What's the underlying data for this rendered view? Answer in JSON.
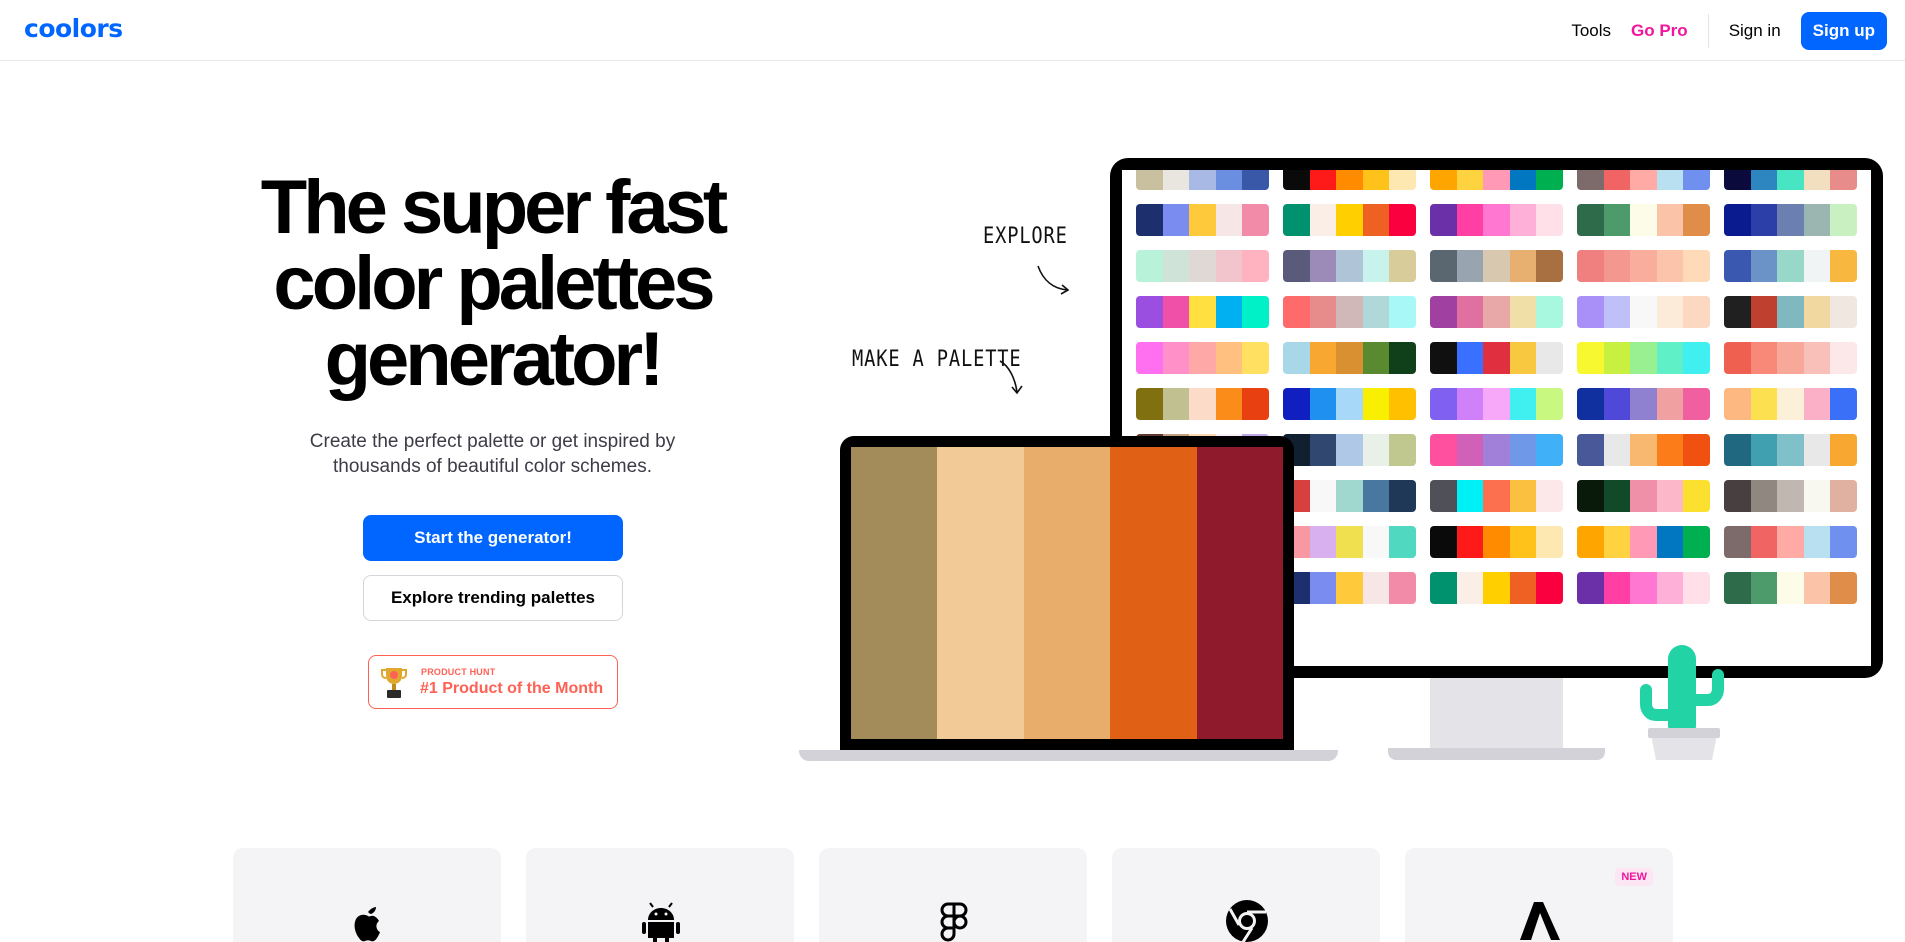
{
  "header": {
    "logo": "coolors",
    "nav": {
      "tools": "Tools",
      "go_pro": "Go Pro",
      "sign_in": "Sign in",
      "sign_up": "Sign up"
    }
  },
  "hero": {
    "title_lines": [
      "The super fast",
      "color palettes",
      "generator!"
    ],
    "subtitle_line1": "Create the perfect palette or get inspired by",
    "subtitle_line2": "thousands of beautiful color schemes.",
    "primary_button": "Start the generator!",
    "secondary_button": "Explore trending palettes",
    "badge": {
      "small": "PRODUCT HUNT",
      "big": "#1 Product of the Month"
    }
  },
  "illustration": {
    "explore_label": "EXPLORE",
    "make_label": "MAKE A PALETTE",
    "laptop_palette": [
      "#a38c5a",
      "#f2ca97",
      "#e8ad6b",
      "#e06016",
      "#8f1a2b"
    ],
    "monitor_palettes": [
      [
        "#c9c0a0",
        "#e8e6df",
        "#a8b9e6",
        "#6b8fe0",
        "#3a58a8"
      ],
      [
        "#0a0a0a",
        "#ff1a1a",
        "#ff8c00",
        "#ffc21a",
        "#fce8b0"
      ],
      [
        "#ffa500",
        "#ffd23f",
        "#ff99b6",
        "#0077c0",
        "#00b050"
      ],
      [
        "#7d6b6b",
        "#f06464",
        "#ffaaa5",
        "#b8e0f0",
        "#7090f0"
      ],
      [
        "#0a0a3c",
        "#2e86c1",
        "#48e5c2",
        "#f2dfc0",
        "#e88b8b"
      ],
      [
        "#1e2f6e",
        "#7a8cf0",
        "#ffc93c",
        "#f7e6e6",
        "#f28ba8"
      ],
      [
        "#00916e",
        "#fbeee6",
        "#ffcf00",
        "#ee6123",
        "#fa003f"
      ],
      [
        "#6b2fa8",
        "#ff3fa4",
        "#ff77d0",
        "#ffb0d9",
        "#ffe0e8"
      ],
      [
        "#2e6b4a",
        "#4d9a6a",
        "#fcfce8",
        "#fbc4a8",
        "#e08d4a"
      ],
      [
        "#0a1a8f",
        "#2c3fa8",
        "#6b7fb0",
        "#9bb5b0",
        "#c8f0c0"
      ],
      [
        "#b8f2d8",
        "#cfe3d8",
        "#e0d8d5",
        "#f2c4cc",
        "#ffb3c0"
      ],
      [
        "#5a5a7a",
        "#9c8ab8",
        "#b0c4d8",
        "#c8f2ec",
        "#d8cc9a"
      ],
      [
        "#5a6670",
        "#98a4b0",
        "#d8c8b0",
        "#e8b070",
        "#a87040"
      ],
      [
        "#f08080",
        "#f4978e",
        "#f8ad9d",
        "#fbc4ab",
        "#ffdab9"
      ],
      [
        "#3a58b0",
        "#6b93c8",
        "#98d8c8",
        "#f0f4f4",
        "#f8b840"
      ],
      [
        "#9a4fe0",
        "#f050a8",
        "#ffe040",
        "#00b0f0",
        "#00f0c8"
      ],
      [
        "#ff6b6b",
        "#e88b8b",
        "#d0b8b8",
        "#b0d8d8",
        "#a8f8f8"
      ],
      [
        "#a040a0",
        "#e070a0",
        "#e8a8a8",
        "#f0e0a8",
        "#a8f8e0"
      ],
      [
        "#a890f8",
        "#c0c0f8",
        "#f8f8f8",
        "#fcebd8",
        "#fcd8c0"
      ],
      [
        "#202020",
        "#c04030",
        "#80b8c0",
        "#f0d8a0",
        "#f0e8e0"
      ],
      [
        "#ff70f0",
        "#ff90c8",
        "#ffa8a8",
        "#ffc080",
        "#ffe060"
      ],
      [
        "#a8d8e8",
        "#f8a830",
        "#d89030",
        "#5a8a30",
        "#10401a"
      ],
      [
        "#101010",
        "#3a70ff",
        "#e03040",
        "#f8c840",
        "#e8e8e8"
      ],
      [
        "#f8f830",
        "#c8f040",
        "#98f090",
        "#60f0c8",
        "#40f0f0"
      ],
      [
        "#f06050",
        "#f88878",
        "#f8a898",
        "#f8c0b8",
        "#fce8e8"
      ],
      [
        "#807010",
        "#c0c090",
        "#fcdcc8",
        "#fc8c1a",
        "#e84010"
      ],
      [
        "#1020c0",
        "#2090f0",
        "#a8d8f8",
        "#f8f000",
        "#ffc000"
      ],
      [
        "#8060f0",
        "#d080f8",
        "#f8a8f8",
        "#40f0f0",
        "#c8f880"
      ],
      [
        "#1030a0",
        "#5048d8",
        "#9080d0",
        "#f0a0a0",
        "#f060a0"
      ],
      [
        "#fcb880",
        "#fce050",
        "#fcf0d8",
        "#fcb0c8",
        "#3a70f8"
      ],
      [
        "#603830",
        "#c0a080",
        "#fcd8b0",
        "#f8f0f8",
        "#c0a8e8"
      ],
      [
        "#102030",
        "#304870",
        "#b0c8e8",
        "#e8f0e8",
        "#c0c890"
      ],
      [
        "#ff50a0",
        "#d060b8",
        "#a080d8",
        "#7098e8",
        "#40b0f8"
      ],
      [
        "#485898",
        "#e8e8e8",
        "#f8b870",
        "#fc7c1a",
        "#f05010"
      ],
      [
        "#206880",
        "#40a0b0",
        "#80c0c8",
        "#e8e8e8",
        "#f8a830"
      ],
      [
        "#5098e0",
        "#80c0f8",
        "#ffffff",
        "#fce050",
        "#f85080"
      ],
      [
        "#d84040",
        "#f8f8f8",
        "#a0d8d0",
        "#4878a0",
        "#203858"
      ],
      [
        "#505058",
        "#00f0f8",
        "#fc7050",
        "#fcc040",
        "#fce8e8"
      ],
      [
        "#0a1a0a",
        "#104a28",
        "#f090a8",
        "#fcb8c8",
        "#fce030"
      ],
      [
        "#484040",
        "#908880",
        "#c0b8b0",
        "#f8f8f0",
        "#e0b0a0"
      ],
      [
        "#205880",
        "#40a0a0",
        "#60d0a0",
        "#98f0a0",
        "#d0f8d0"
      ],
      [
        "#f898a0",
        "#d8b0f0",
        "#f0e050",
        "#f8f8f8",
        "#50d8c0"
      ],
      [
        "#0a0a0a",
        "#ff1a1a",
        "#ff8c00",
        "#ffc21a",
        "#fce8b0"
      ],
      [
        "#ffa500",
        "#ffd23f",
        "#ff99b6",
        "#0077c0",
        "#00b050"
      ],
      [
        "#7d6b6b",
        "#f06464",
        "#ffaaa5",
        "#b8e0f0",
        "#7090f0"
      ],
      [
        "#0a0a3c",
        "#2e86c1",
        "#48e5c2",
        "#f2dfc0",
        "#e88b8b"
      ],
      [
        "#1e2f6e",
        "#7a8cf0",
        "#ffc93c",
        "#f7e6e6",
        "#f28ba8"
      ],
      [
        "#00916e",
        "#fbeee6",
        "#ffcf00",
        "#ee6123",
        "#fa003f"
      ],
      [
        "#6b2fa8",
        "#ff3fa4",
        "#ff77d0",
        "#ffb0d9",
        "#ffe0e8"
      ],
      [
        "#2e6b4a",
        "#4d9a6a",
        "#fcfce8",
        "#fbc4a8",
        "#e08d4a"
      ],
      [
        "#0a1a8f",
        "#2c3fa8",
        "#6b7fb0",
        "#9bb5b0",
        "#c8f0c0"
      ]
    ]
  },
  "platforms": [
    {
      "icon": "apple-icon",
      "new": ""
    },
    {
      "icon": "android-icon",
      "new": ""
    },
    {
      "icon": "figma-icon",
      "new": ""
    },
    {
      "icon": "chrome-icon",
      "new": ""
    },
    {
      "icon": "adobe-icon",
      "new": "NEW"
    }
  ],
  "colors": {
    "brand": "#0066ff",
    "pro": "#f0169e",
    "product_hunt": "#ff6154"
  }
}
